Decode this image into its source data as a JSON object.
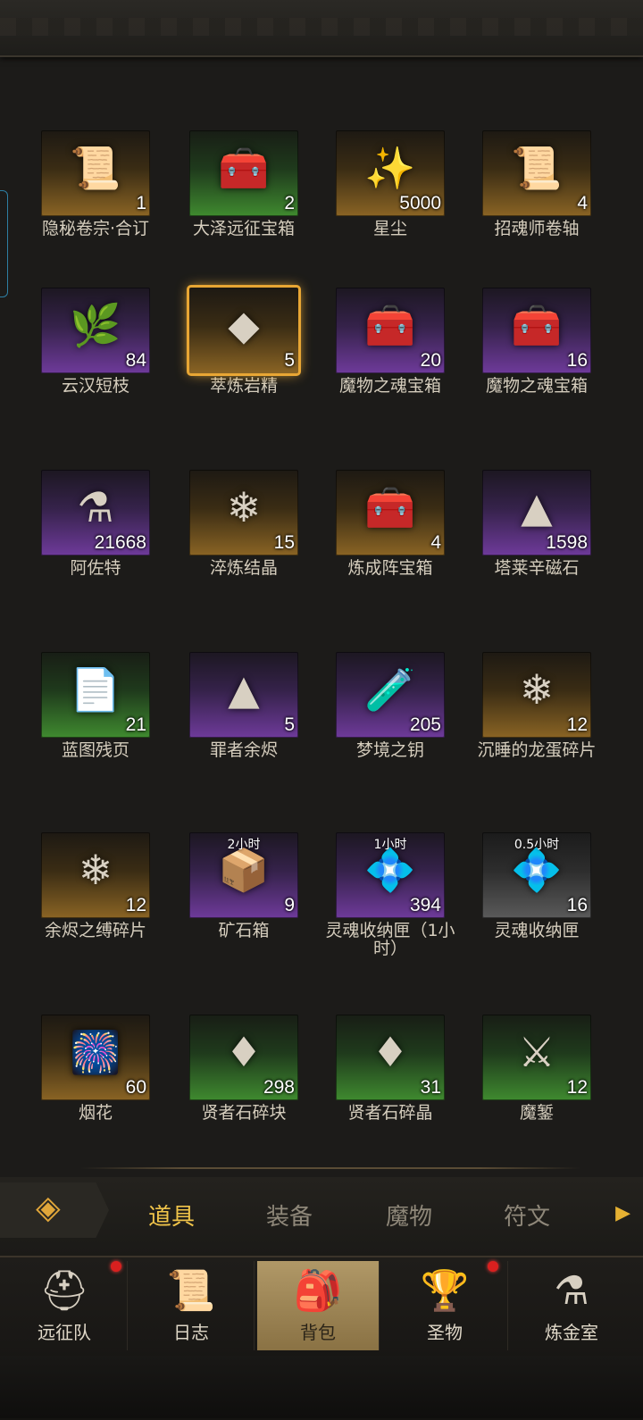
{
  "items": [
    {
      "name": "隐秘卷宗·合订",
      "count": "1",
      "rarity": "gold",
      "icon": "scroll-icon",
      "glyph": "📜"
    },
    {
      "name": "大泽远征宝箱",
      "count": "2",
      "rarity": "green",
      "icon": "chest-icon",
      "glyph": "🧰"
    },
    {
      "name": "星尘",
      "count": "5000",
      "rarity": "gold",
      "icon": "stardust-icon",
      "glyph": "✨"
    },
    {
      "name": "招魂师卷轴",
      "count": "4",
      "rarity": "gold",
      "icon": "scroll-icon",
      "glyph": "📜"
    },
    {
      "name": "云汉短枝",
      "count": "84",
      "rarity": "purple",
      "icon": "branch-icon",
      "glyph": "🌿"
    },
    {
      "name": "萃炼岩精",
      "count": "5",
      "rarity": "gold",
      "icon": "crystal-icon",
      "glyph": "◆",
      "selected": true
    },
    {
      "name": "魔物之魂宝箱",
      "count": "20",
      "rarity": "purple",
      "icon": "chest-icon",
      "glyph": "🧰"
    },
    {
      "name": "魔物之魂宝箱",
      "count": "16",
      "rarity": "purple",
      "icon": "chest-icon",
      "glyph": "🧰"
    },
    {
      "name": "阿佐特",
      "count": "21668",
      "rarity": "purple",
      "icon": "vial-icon",
      "glyph": "⚗"
    },
    {
      "name": "淬炼结晶",
      "count": "15",
      "rarity": "gold",
      "icon": "crystal-icon",
      "glyph": "❄"
    },
    {
      "name": "炼成阵宝箱",
      "count": "4",
      "rarity": "gold",
      "icon": "chest-icon",
      "glyph": "🧰"
    },
    {
      "name": "塔莱辛磁石",
      "count": "1598",
      "rarity": "purple",
      "icon": "stone-icon",
      "glyph": "▲"
    },
    {
      "name": "蓝图残页",
      "count": "21",
      "rarity": "green",
      "icon": "blueprint-icon",
      "glyph": "📄"
    },
    {
      "name": "罪者余烬",
      "count": "5",
      "rarity": "purple",
      "icon": "ash-icon",
      "glyph": "▲"
    },
    {
      "name": "梦境之钥",
      "count": "205",
      "rarity": "purple",
      "icon": "bottle-icon",
      "glyph": "🧪"
    },
    {
      "name": "沉睡的龙蛋碎片",
      "count": "12",
      "rarity": "gold",
      "icon": "shard-icon",
      "glyph": "❄"
    },
    {
      "name": "余烬之缚碎片",
      "count": "12",
      "rarity": "gold",
      "icon": "shard-icon",
      "glyph": "❄"
    },
    {
      "name": "矿石箱",
      "count": "9",
      "rarity": "purple",
      "icon": "crate-icon",
      "glyph": "📦",
      "timer": "2小时"
    },
    {
      "name": "灵魂收纳匣（1小时）",
      "count": "394",
      "rarity": "purple",
      "icon": "casket-icon",
      "glyph": "💠",
      "timer": "1小时"
    },
    {
      "name": "灵魂收纳匣",
      "count": "16",
      "rarity": "grey",
      "icon": "casket-icon",
      "glyph": "💠",
      "timer": "0.5小时"
    },
    {
      "name": "烟花",
      "count": "60",
      "rarity": "gold",
      "icon": "firework-icon",
      "glyph": "🎆"
    },
    {
      "name": "贤者石碎块",
      "count": "298",
      "rarity": "green",
      "icon": "gem-icon",
      "glyph": "♦"
    },
    {
      "name": "贤者石碎晶",
      "count": "31",
      "rarity": "green",
      "icon": "gem-icon",
      "glyph": "♦"
    },
    {
      "name": "魔錾",
      "count": "12",
      "rarity": "green",
      "icon": "chisel-icon",
      "glyph": "⚔"
    }
  ],
  "tabs": {
    "items": "道具",
    "equipment": "装备",
    "monsters": "魔物",
    "runes": "符文"
  },
  "nav": {
    "expedition": "远征队",
    "journal": "日志",
    "backpack": "背包",
    "relics": "圣物",
    "alchemy": "炼金室"
  },
  "colors": {
    "accent": "#e8a634",
    "badge": "#d9201f"
  }
}
